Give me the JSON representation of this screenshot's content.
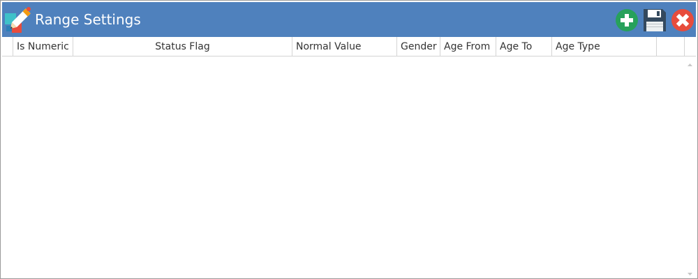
{
  "window": {
    "title": "Range Settings"
  },
  "icons": {
    "app": "edit-pencil-icon",
    "add": "plus-circle-icon",
    "save": "floppy-disk-icon",
    "close": "close-circle-icon"
  },
  "colors": {
    "titlebar": "#4f81bd",
    "add_button": "#27a15b",
    "save_button": "#34495e",
    "close_button": "#e74c3c",
    "grid_border": "#d4d4d4"
  },
  "grid": {
    "columns": [
      {
        "label": "Is Numeric"
      },
      {
        "label": "Status Flag"
      },
      {
        "label": "Normal Value"
      },
      {
        "label": "Gender"
      },
      {
        "label": "Age From"
      },
      {
        "label": "Age To"
      },
      {
        "label": "Age Type"
      }
    ],
    "rows": []
  }
}
